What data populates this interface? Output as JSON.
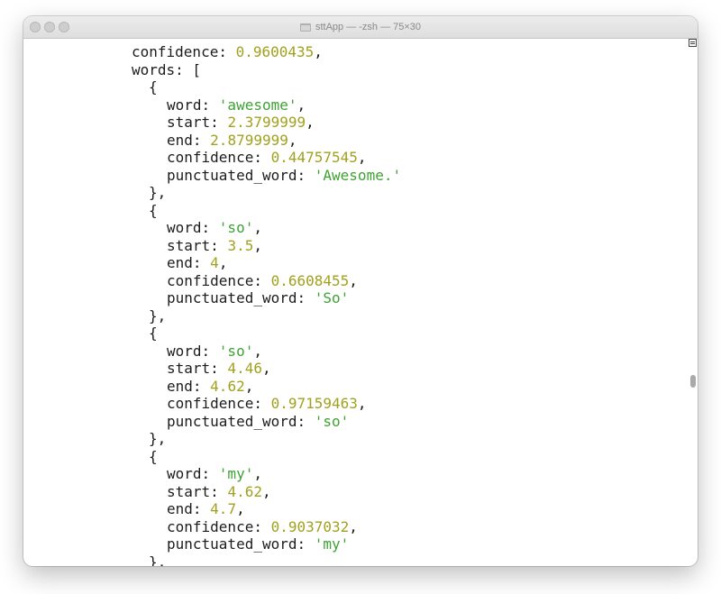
{
  "window": {
    "title": "sttApp — -zsh — 75×30"
  },
  "lines": [
    [
      {
        "t": "key",
        "v": "confidence: "
      },
      {
        "t": "num",
        "v": "0.9600435"
      },
      {
        "t": "punc",
        "v": ","
      }
    ],
    [
      {
        "t": "key",
        "v": "words: ["
      }
    ],
    [
      {
        "t": "punc",
        "v": "{"
      }
    ],
    [
      {
        "t": "key",
        "v": "word: "
      },
      {
        "t": "str",
        "v": "'awesome'"
      },
      {
        "t": "punc",
        "v": ","
      }
    ],
    [
      {
        "t": "key",
        "v": "start: "
      },
      {
        "t": "num",
        "v": "2.3799999"
      },
      {
        "t": "punc",
        "v": ","
      }
    ],
    [
      {
        "t": "key",
        "v": "end: "
      },
      {
        "t": "num",
        "v": "2.8799999"
      },
      {
        "t": "punc",
        "v": ","
      }
    ],
    [
      {
        "t": "key",
        "v": "confidence: "
      },
      {
        "t": "num",
        "v": "0.44757545"
      },
      {
        "t": "punc",
        "v": ","
      }
    ],
    [
      {
        "t": "key",
        "v": "punctuated_word: "
      },
      {
        "t": "str",
        "v": "'Awesome.'"
      }
    ],
    [
      {
        "t": "punc",
        "v": "},"
      }
    ],
    [
      {
        "t": "punc",
        "v": "{"
      }
    ],
    [
      {
        "t": "key",
        "v": "word: "
      },
      {
        "t": "str",
        "v": "'so'"
      },
      {
        "t": "punc",
        "v": ","
      }
    ],
    [
      {
        "t": "key",
        "v": "start: "
      },
      {
        "t": "num",
        "v": "3.5"
      },
      {
        "t": "punc",
        "v": ","
      }
    ],
    [
      {
        "t": "key",
        "v": "end: "
      },
      {
        "t": "num",
        "v": "4"
      },
      {
        "t": "punc",
        "v": ","
      }
    ],
    [
      {
        "t": "key",
        "v": "confidence: "
      },
      {
        "t": "num",
        "v": "0.6608455"
      },
      {
        "t": "punc",
        "v": ","
      }
    ],
    [
      {
        "t": "key",
        "v": "punctuated_word: "
      },
      {
        "t": "str",
        "v": "'So'"
      }
    ],
    [
      {
        "t": "punc",
        "v": "},"
      }
    ],
    [
      {
        "t": "punc",
        "v": "{"
      }
    ],
    [
      {
        "t": "key",
        "v": "word: "
      },
      {
        "t": "str",
        "v": "'so'"
      },
      {
        "t": "punc",
        "v": ","
      }
    ],
    [
      {
        "t": "key",
        "v": "start: "
      },
      {
        "t": "num",
        "v": "4.46"
      },
      {
        "t": "punc",
        "v": ","
      }
    ],
    [
      {
        "t": "key",
        "v": "end: "
      },
      {
        "t": "num",
        "v": "4.62"
      },
      {
        "t": "punc",
        "v": ","
      }
    ],
    [
      {
        "t": "key",
        "v": "confidence: "
      },
      {
        "t": "num",
        "v": "0.97159463"
      },
      {
        "t": "punc",
        "v": ","
      }
    ],
    [
      {
        "t": "key",
        "v": "punctuated_word: "
      },
      {
        "t": "str",
        "v": "'so'"
      }
    ],
    [
      {
        "t": "punc",
        "v": "},"
      }
    ],
    [
      {
        "t": "punc",
        "v": "{"
      }
    ],
    [
      {
        "t": "key",
        "v": "word: "
      },
      {
        "t": "str",
        "v": "'my'"
      },
      {
        "t": "punc",
        "v": ","
      }
    ],
    [
      {
        "t": "key",
        "v": "start: "
      },
      {
        "t": "num",
        "v": "4.62"
      },
      {
        "t": "punc",
        "v": ","
      }
    ],
    [
      {
        "t": "key",
        "v": "end: "
      },
      {
        "t": "num",
        "v": "4.7"
      },
      {
        "t": "punc",
        "v": ","
      }
    ],
    [
      {
        "t": "key",
        "v": "confidence: "
      },
      {
        "t": "num",
        "v": "0.9037032"
      },
      {
        "t": "punc",
        "v": ","
      }
    ],
    [
      {
        "t": "key",
        "v": "punctuated_word: "
      },
      {
        "t": "str",
        "v": "'my'"
      }
    ],
    [
      {
        "t": "punc",
        "v": "},"
      }
    ]
  ],
  "colors": {
    "number": "#a1a11f",
    "string": "#3da333",
    "text": "#1c1c1c"
  }
}
